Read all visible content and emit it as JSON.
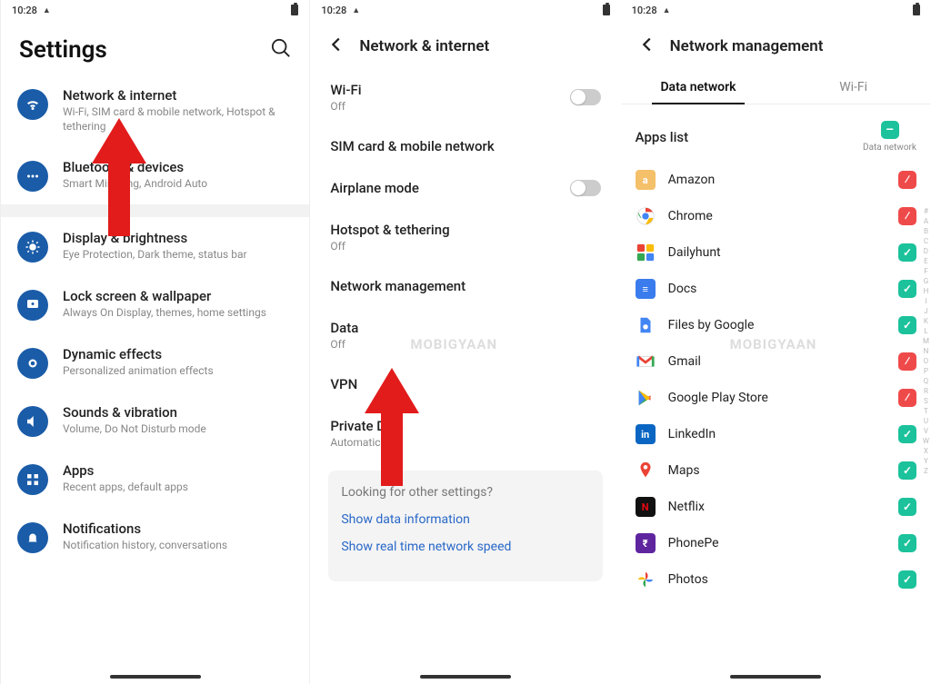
{
  "status": {
    "time": "10:28"
  },
  "panel1": {
    "title": "Settings",
    "items": [
      {
        "title": "Network & internet",
        "sub": "Wi-Fi, SIM card & mobile network, Hotspot & tethering",
        "icon": "wifi"
      },
      {
        "title": "Bluetooth & devices",
        "sub": "Smart Mirroring, Android Auto",
        "icon": "dots"
      },
      {
        "title": "Display & brightness",
        "sub": "Eye Protection, Dark theme, status bar",
        "icon": "brightness"
      },
      {
        "title": "Lock screen & wallpaper",
        "sub": "Always On Display, themes, home settings",
        "icon": "lock"
      },
      {
        "title": "Dynamic effects",
        "sub": "Personalized animation effects",
        "icon": "effects"
      },
      {
        "title": "Sounds & vibration",
        "sub": "Volume, Do Not Disturb mode",
        "icon": "sound"
      },
      {
        "title": "Apps",
        "sub": "Recent apps, default apps",
        "icon": "apps"
      },
      {
        "title": "Notifications",
        "sub": "Notification history, conversations",
        "icon": "notif"
      }
    ]
  },
  "panel2": {
    "title": "Network & internet",
    "items": [
      {
        "title": "Wi-Fi",
        "sub": "Off",
        "toggle": true
      },
      {
        "title": "SIM card & mobile network",
        "sub": ""
      },
      {
        "title": "Airplane mode",
        "sub": "",
        "toggle": true
      },
      {
        "title": "Hotspot & tethering",
        "sub": "Off"
      },
      {
        "title": "Network management",
        "sub": ""
      },
      {
        "title": "Data",
        "sub": "Off"
      },
      {
        "title": "VPN",
        "sub": ""
      },
      {
        "title": "Private DNS",
        "sub": "Automatic"
      }
    ],
    "extra": {
      "q": "Looking for other settings?",
      "link1": "Show data information",
      "link2": "Show real time network speed"
    }
  },
  "panel3": {
    "title": "Network management",
    "tabs": {
      "left": "Data network",
      "right": "Wi-Fi"
    },
    "header": {
      "label": "Apps list",
      "right": "Data network"
    },
    "apps": [
      {
        "name": "Amazon",
        "allowed": false,
        "color": "#f5c06a",
        "letter": "a"
      },
      {
        "name": "Chrome",
        "allowed": false,
        "color": "#fff",
        "chrome": true
      },
      {
        "name": "Dailyhunt",
        "allowed": true,
        "color": "#fff",
        "dh": true
      },
      {
        "name": "Docs",
        "allowed": true,
        "color": "#3a7ced",
        "letter": "≡"
      },
      {
        "name": "Files by Google",
        "allowed": true,
        "color": "#fff",
        "files": true
      },
      {
        "name": "Gmail",
        "allowed": false,
        "color": "#fff",
        "gmail": true
      },
      {
        "name": "Google Play Store",
        "allowed": false,
        "color": "#fff",
        "play": true
      },
      {
        "name": "LinkedIn",
        "allowed": true,
        "color": "#0a66c2",
        "letter": "in"
      },
      {
        "name": "Maps",
        "allowed": true,
        "color": "#fff",
        "maps": true
      },
      {
        "name": "Netflix",
        "allowed": true,
        "color": "#111",
        "letter": "N",
        "txtcolor": "#e50914"
      },
      {
        "name": "PhonePe",
        "allowed": true,
        "color": "#5f259f",
        "letter": "₹"
      },
      {
        "name": "Photos",
        "allowed": true,
        "color": "#fff",
        "photos": true
      }
    ],
    "alpha": [
      "#",
      "A",
      "B",
      "C",
      "D",
      "E",
      "F",
      "G",
      "H",
      "I",
      "J",
      "K",
      "L",
      "M",
      "N",
      "O",
      "P",
      "Q",
      "R",
      "S",
      "T",
      "U",
      "V",
      "W",
      "X",
      "Y",
      "Z"
    ]
  },
  "watermark": "MOBIGYAAN"
}
